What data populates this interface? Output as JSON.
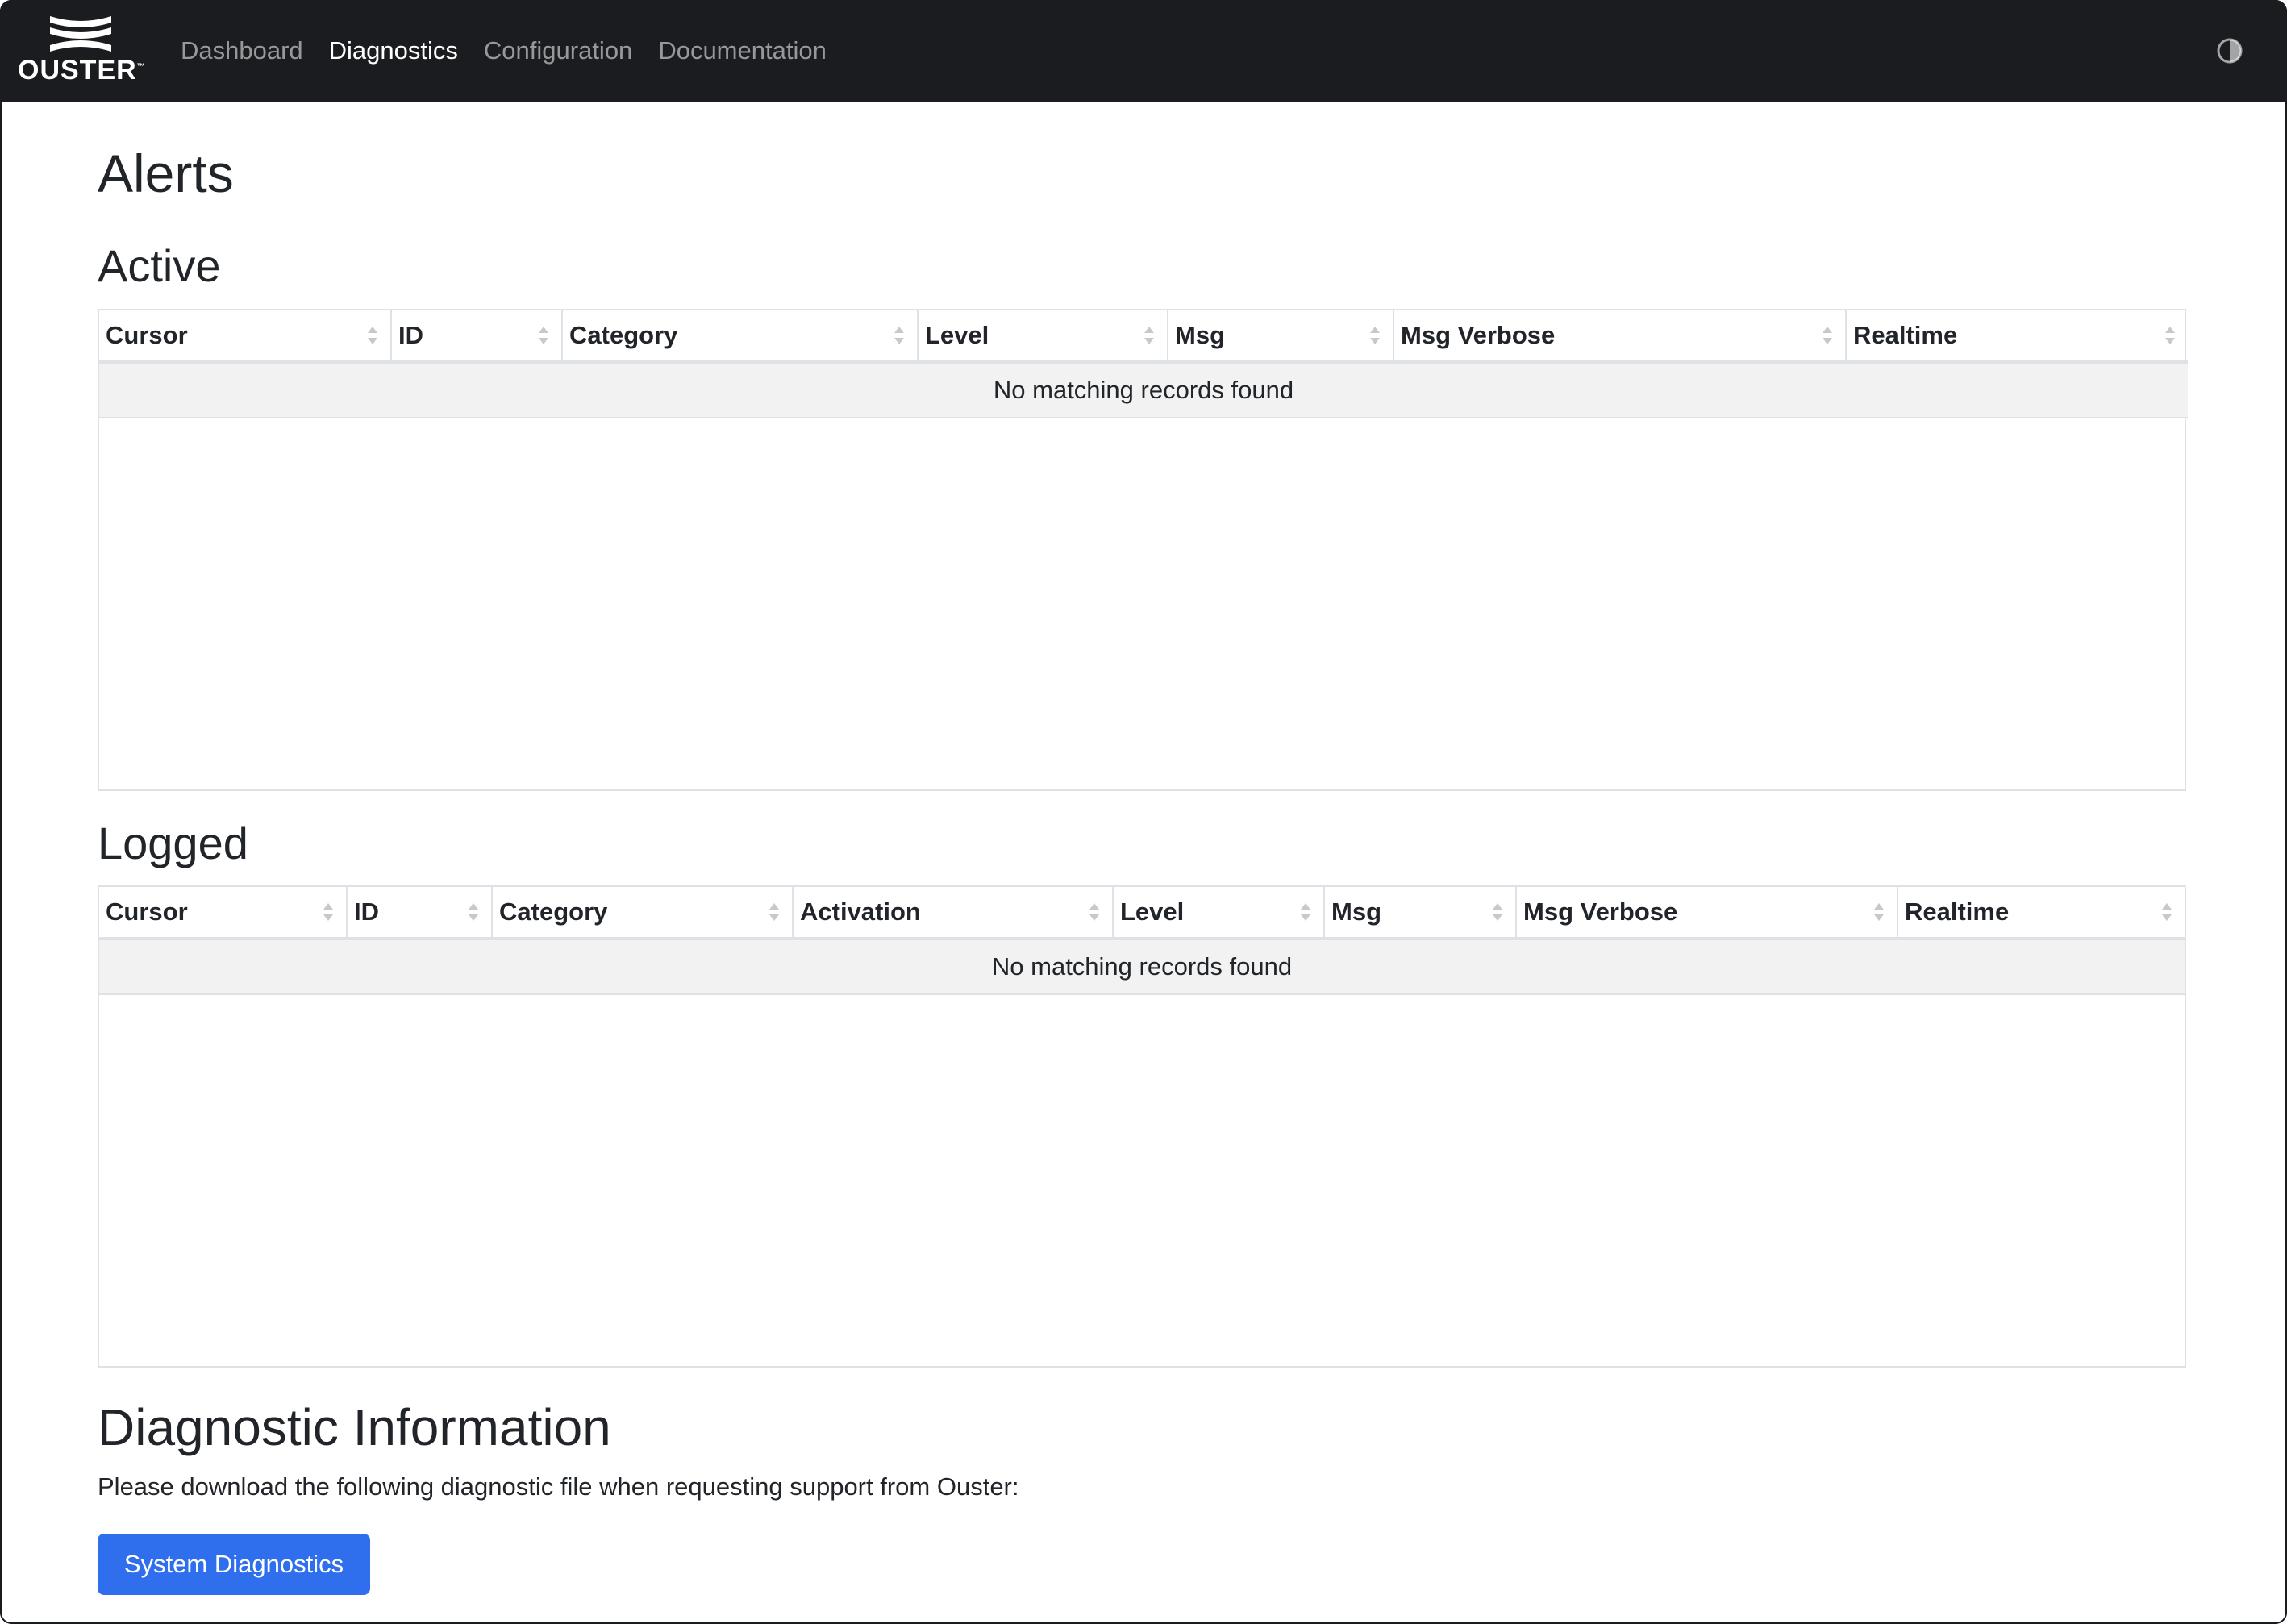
{
  "brand": {
    "name": "OUSTER",
    "mark": "™"
  },
  "nav": {
    "items": [
      {
        "label": "Dashboard",
        "active": false
      },
      {
        "label": "Diagnostics",
        "active": true
      },
      {
        "label": "Configuration",
        "active": false
      },
      {
        "label": "Documentation",
        "active": false
      }
    ],
    "theme_toggle_icon": "contrast-icon"
  },
  "page": {
    "title": "Alerts"
  },
  "active": {
    "heading": "Active",
    "columns": [
      "Cursor",
      "ID",
      "Category",
      "Level",
      "Msg",
      "Msg Verbose",
      "Realtime"
    ],
    "empty_message": "No matching records found"
  },
  "logged": {
    "heading": "Logged",
    "columns": [
      "Cursor",
      "ID",
      "Category",
      "Activation",
      "Level",
      "Msg",
      "Msg Verbose",
      "Realtime"
    ],
    "empty_message": "No matching records found"
  },
  "diagnostics": {
    "heading": "Diagnostic Information",
    "text": "Please download the following diagnostic file when requesting support from Ouster:",
    "button_label": "System Diagnostics"
  },
  "colors": {
    "navbar_bg": "#1b1c20",
    "primary_button": "#2f6fed",
    "empty_row_bg": "#f2f2f2"
  }
}
